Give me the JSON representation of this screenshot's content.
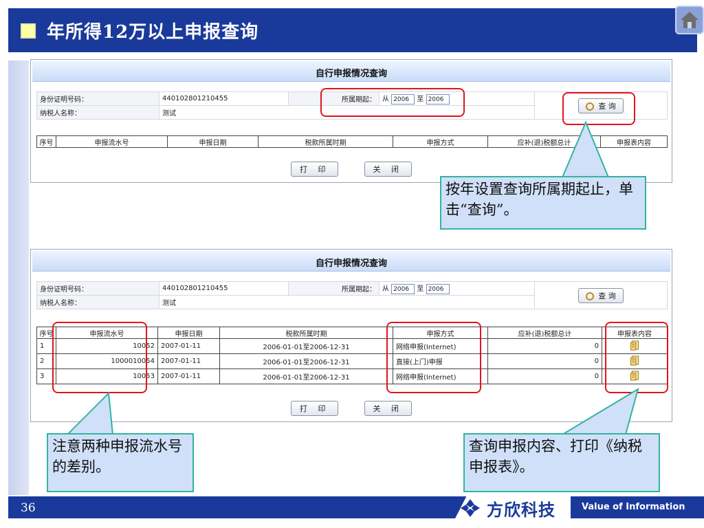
{
  "slide": {
    "title": "年所得12万以上申报查询",
    "page_number": "36",
    "logo_text": "方欣科技",
    "slogan": "Value of Information",
    "colors": {
      "title_bar": "#1a3a9b",
      "highlight": "#e0141e",
      "callout_fill": "#cfe0f8",
      "callout_border": "#35b3a0"
    },
    "icons": {
      "home": "home-icon",
      "logo": "logo-mark-icon"
    }
  },
  "window_top": {
    "title": "自行申报情况查询",
    "id_label": "身份证明号码：",
    "id_value": "440102801210455",
    "name_label": "纳税人名称：",
    "name_value": "测试",
    "period_label": "所属期起：",
    "from_label": "从",
    "from_value": "2006",
    "to_label": "至",
    "to_value": "2006",
    "query_button": "查 询",
    "columns": [
      "序号",
      "申报流水号",
      "申报日期",
      "税款所属时期",
      "申报方式",
      "应补(退)税额总计",
      "申报表内容"
    ],
    "print_button": "打 印",
    "close_button": "关 闭"
  },
  "window_bottom": {
    "title": "自行申报情况查询",
    "id_label": "身份证明号码：",
    "id_value": "440102801210455",
    "name_label": "纳税人名称：",
    "name_value": "测试",
    "period_label": "所属期起：",
    "from_label": "从",
    "from_value": "2006",
    "to_label": "至",
    "to_value": "2006",
    "query_button": "查 询",
    "columns": [
      "序号",
      "申报流水号",
      "申报日期",
      "税款所属时期",
      "申报方式",
      "应补(退)税额总计",
      "申报表内容"
    ],
    "rows": [
      {
        "index": "1",
        "serial": "10052",
        "date": "2007-01-11",
        "period": "2006-01-01至2006-12-31",
        "method": "网络申报(Internet)",
        "amount": "0",
        "content_icon": "document-icon"
      },
      {
        "index": "2",
        "serial": "1000010054",
        "date": "2007-01-11",
        "period": "2006-01-01至2006-12-31",
        "method": "直接(上门)申报",
        "amount": "0",
        "content_icon": "document-icon"
      },
      {
        "index": "3",
        "serial": "10053",
        "date": "2007-01-11",
        "period": "2006-01-01至2006-12-31",
        "method": "网络申报(Internet)",
        "amount": "0",
        "content_icon": "document-icon"
      }
    ],
    "print_button": "打 印",
    "close_button": "关 闭"
  },
  "callouts": {
    "query_note": "按年设置查询所属期起止，单击“查询”。",
    "serial_note": "注意两种申报流水号的差别。",
    "content_note": "查询申报内容、打印《纳税申报表》。"
  }
}
